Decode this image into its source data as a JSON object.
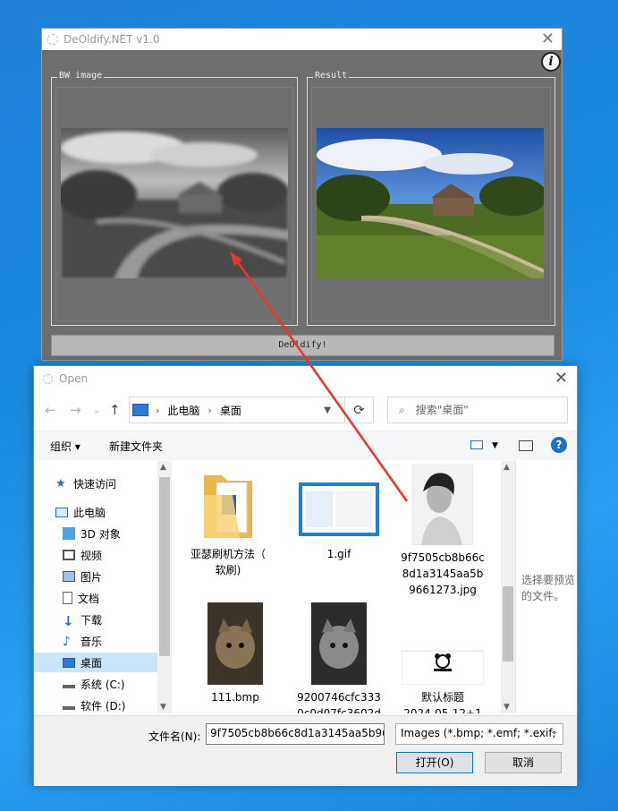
{
  "app": {
    "title": "DeOldify.NET v1.0",
    "close_glyph": "✕",
    "info_glyph": "i",
    "bw_group_label": "BW image",
    "result_group_label": "Result",
    "deoldify_button": "DeOldify!"
  },
  "dialog": {
    "title": "Open",
    "close_glyph": "✕",
    "breadcrumb": [
      "此电脑",
      "桌面"
    ],
    "search_placeholder": "搜索\"桌面\"",
    "toolbar": {
      "organize": "组织 ▾",
      "new_folder": "新建文件夹"
    },
    "sidebar": [
      {
        "label": "快速访问",
        "icon": "star-icon"
      },
      {
        "label": "此电脑",
        "icon": "pc-icon"
      },
      {
        "label": "3D 对象",
        "icon": "cube-icon"
      },
      {
        "label": "视频",
        "icon": "video-icon"
      },
      {
        "label": "图片",
        "icon": "pictures-icon"
      },
      {
        "label": "文档",
        "icon": "document-icon"
      },
      {
        "label": "下载",
        "icon": "download-icon"
      },
      {
        "label": "音乐",
        "icon": "music-icon"
      },
      {
        "label": "桌面",
        "icon": "desktop-icon",
        "selected": true
      },
      {
        "label": "系统 (C:)",
        "icon": "drive-icon"
      },
      {
        "label": "软件 (D:)",
        "icon": "drive-icon"
      }
    ],
    "files": [
      {
        "name": "亚瑟刷机方法（\n软刷)",
        "type": "folder"
      },
      {
        "name": "1.gif",
        "type": "screenshot"
      },
      {
        "name": "9f7505cb8b66c\n8d1a3145aa5b\n9661273.jpg",
        "type": "portrait"
      },
      {
        "name": "111.bmp",
        "type": "cat"
      },
      {
        "name": "9200746cfc333\n0c0d07fc3602d",
        "type": "cat-bw"
      },
      {
        "name": "默认标题\n2024-05-12+1",
        "type": "panda"
      }
    ],
    "preview_text": "选择要预览的文件。",
    "filename_label": "文件名(N):",
    "filename_value": "9f7505cb8b66c8d1a3145aa5b9661273.jpg",
    "filetype": "Images (*.bmp; *.emf; *.exif;",
    "open_button": "打开(O)",
    "cancel_button": "取消"
  },
  "colors": {
    "accent": "#0078d7",
    "annotation_arrow": "#e8362a",
    "selection": "#cce4f7"
  }
}
